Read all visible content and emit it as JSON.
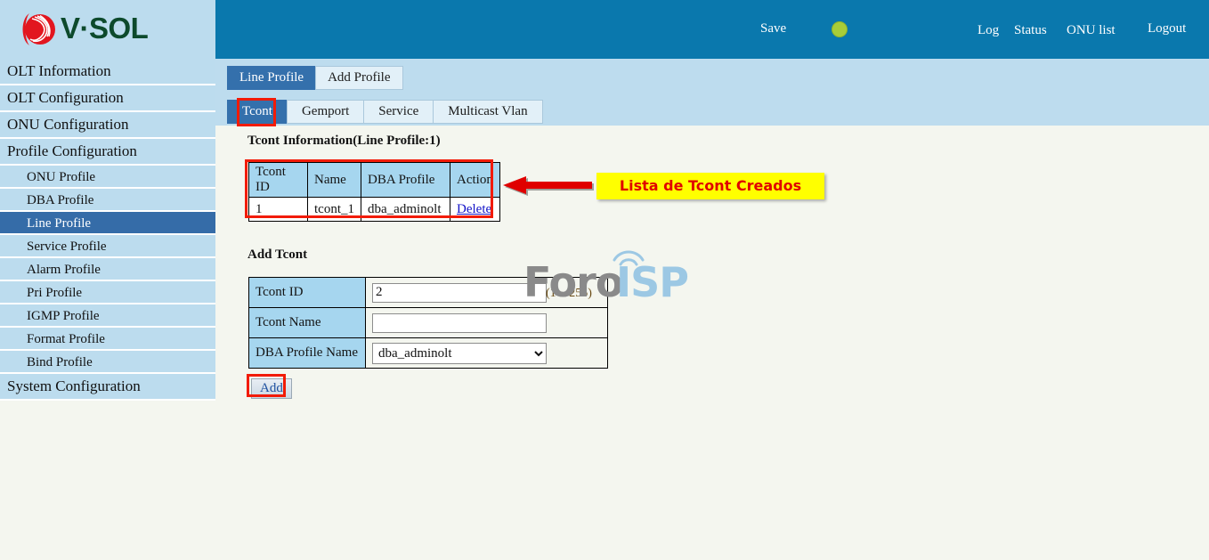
{
  "brand": {
    "logo_text": "V·SOL",
    "logo_icon": "vsol-swirl-icon",
    "logo_color": "#0d4a2c",
    "logo_mark_color": "#e2161f"
  },
  "header": {
    "save_label": "Save",
    "indicator_name": "status-indicator-green",
    "indicator_color": "#a8cd38",
    "links": [
      {
        "label": "Log"
      },
      {
        "label": "Status"
      },
      {
        "label": "ONU list"
      },
      {
        "label": "Logout"
      }
    ]
  },
  "sidebar": {
    "items": [
      {
        "label": "OLT Information",
        "level": "top",
        "active": false
      },
      {
        "label": "OLT Configuration",
        "level": "top",
        "active": false
      },
      {
        "label": "ONU Configuration",
        "level": "top",
        "active": false
      },
      {
        "label": "Profile Configuration",
        "level": "top",
        "active": false
      },
      {
        "label": "ONU Profile",
        "level": "sub",
        "active": false
      },
      {
        "label": "DBA Profile",
        "level": "sub",
        "active": false
      },
      {
        "label": "Line Profile",
        "level": "sub",
        "active": true
      },
      {
        "label": "Service Profile",
        "level": "sub",
        "active": false
      },
      {
        "label": "Alarm Profile",
        "level": "sub",
        "active": false
      },
      {
        "label": "Pri Profile",
        "level": "sub",
        "active": false
      },
      {
        "label": "IGMP Profile",
        "level": "sub",
        "active": false
      },
      {
        "label": "Format Profile",
        "level": "sub",
        "active": false
      },
      {
        "label": "Bind Profile",
        "level": "sub",
        "active": false
      },
      {
        "label": "System Configuration",
        "level": "top",
        "active": false
      }
    ]
  },
  "tabs": {
    "primary": [
      {
        "label": "Line Profile",
        "active": true
      },
      {
        "label": "Add Profile",
        "active": false
      }
    ],
    "secondary": [
      {
        "label": "Tcont",
        "active": true
      },
      {
        "label": "Gemport",
        "active": false
      },
      {
        "label": "Service",
        "active": false
      },
      {
        "label": "Multicast Vlan",
        "active": false
      }
    ]
  },
  "main": {
    "info_title": "Tcont Information(Line Profile:1)",
    "table": {
      "headers": [
        "Tcont ID",
        "Name",
        "DBA Profile",
        "Action"
      ],
      "rows": [
        {
          "tcont_id": "1",
          "name": "tcont_1",
          "dba_profile": "dba_adminolt",
          "action": "Delete"
        }
      ]
    },
    "add_title": "Add Tcont",
    "form": {
      "tcont_id_label": "Tcont ID",
      "tcont_id_value": "2",
      "tcont_id_hint": "(1 ~ 255)",
      "tcont_name_label": "Tcont Name",
      "tcont_name_value": "",
      "tcont_name_placeholder": "",
      "dba_profile_label": "DBA Profile Name",
      "dba_profile_value": "dba_adminolt",
      "dba_profile_options": [
        "dba_adminolt"
      ],
      "add_button": "Add"
    }
  },
  "annotations": {
    "arrow_name": "red-arrow-left",
    "arrow_color": "#e00000",
    "callout_text": "Lista de Tcont Creados",
    "callout_bg": "#ffff00",
    "callout_fg": "#e00000",
    "highlight_color": "#f21b07",
    "highlights": [
      "tcont-tab",
      "tcont-table",
      "add-button"
    ]
  },
  "watermark": {
    "text_primary": "Foro",
    "text_secondary": "ISP",
    "primary_color": "#8a8a8a",
    "secondary_color": "#9cc8e4",
    "icon": "wifi-signal-icon"
  }
}
